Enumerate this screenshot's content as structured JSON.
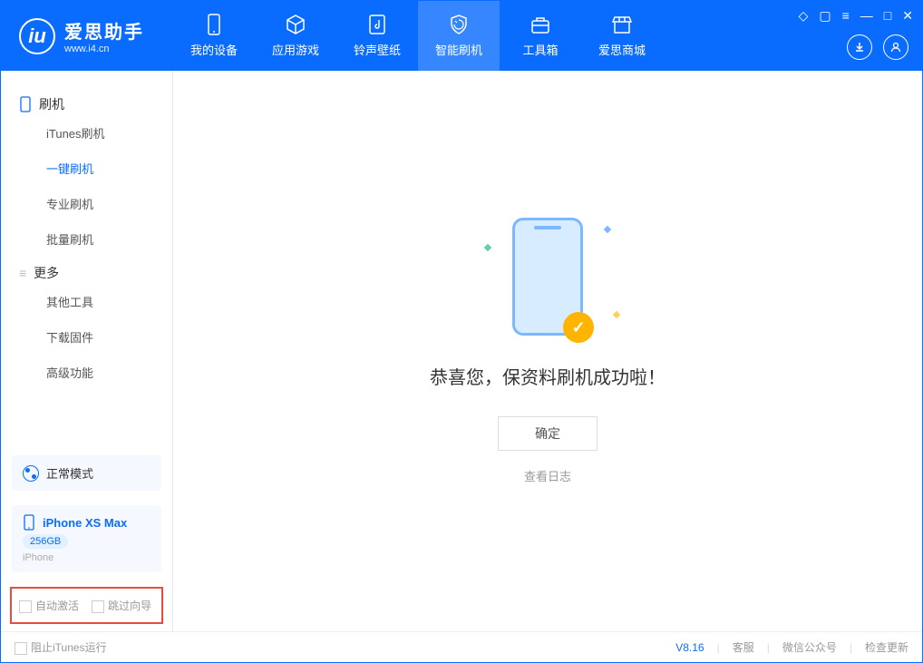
{
  "brand": {
    "name": "爱思助手",
    "site": "www.i4.cn"
  },
  "tabs": {
    "device": "我的设备",
    "apps": "应用游戏",
    "ringtone": "铃声壁纸",
    "flash": "智能刷机",
    "toolbox": "工具箱",
    "store": "爱思商城"
  },
  "sidebar": {
    "section1": "刷机",
    "items1": {
      "itunes": "iTunes刷机",
      "oneclick": "一键刷机",
      "pro": "专业刷机",
      "batch": "批量刷机"
    },
    "section2": "更多",
    "items2": {
      "other": "其他工具",
      "firmware": "下载固件",
      "advanced": "高级功能"
    }
  },
  "deviceMode": "正常模式",
  "device": {
    "name": "iPhone XS Max",
    "capacity": "256GB",
    "type": "iPhone"
  },
  "checkboxes": {
    "autoActivate": "自动激活",
    "skipGuide": "跳过向导"
  },
  "main": {
    "success": "恭喜您，保资料刷机成功啦！",
    "ok": "确定",
    "viewLog": "查看日志"
  },
  "footer": {
    "blockItunes": "阻止iTunes运行",
    "version": "V8.16",
    "support": "客服",
    "wechat": "微信公众号",
    "update": "检查更新"
  }
}
